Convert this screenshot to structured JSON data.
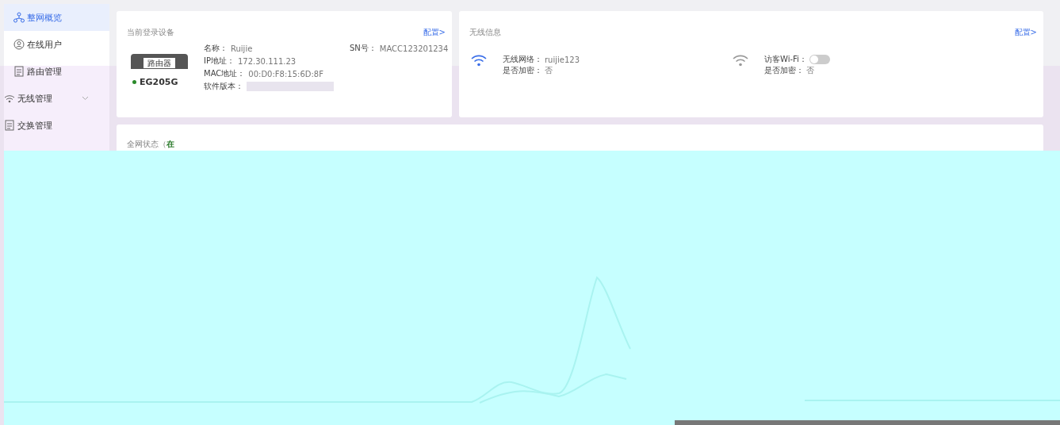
{
  "sidebar": {
    "items": [
      {
        "label": "整网概览",
        "kind": "network",
        "selected": true,
        "expandable": false
      },
      {
        "label": "在线用户",
        "kind": "user",
        "selected": false,
        "expandable": false
      },
      {
        "label": "路由管理",
        "kind": "doc",
        "selected": false,
        "expandable": false
      },
      {
        "label": "无线管理",
        "kind": "wifi",
        "selected": false,
        "expandable": true
      },
      {
        "label": "交换管理",
        "kind": "doc",
        "selected": false,
        "expandable": false
      }
    ]
  },
  "device_card": {
    "title": "当前登录设备",
    "link": "配置>",
    "device_label": "路由器",
    "model": "EG205G",
    "online": true,
    "fields": [
      {
        "label": "名称：",
        "value": "Ruijie"
      },
      {
        "label": "SN号：",
        "value": "MACC123201234"
      },
      {
        "label": "IP地址：",
        "value": "172.30.111.23"
      },
      {
        "label": "MAC地址：",
        "value": "00:D0:F8:15:6D:8F"
      },
      {
        "label": "软件版本：",
        "value_blurred": true
      }
    ]
  },
  "wireless_card": {
    "title": "无线信息",
    "link": "配置>",
    "networks": [
      {
        "kind": "main",
        "label": "无线网络：",
        "value": "ruijie123",
        "encrypt_label": "是否加密：",
        "encrypt_value": "否",
        "active": true
      },
      {
        "kind": "guest",
        "label": "访客Wi-Fi：",
        "on": false,
        "encrypt_label": "是否加密：",
        "encrypt_value": "否",
        "active": false
      }
    ]
  },
  "status_card": {
    "title": "全网状态（**在**"
  }
}
